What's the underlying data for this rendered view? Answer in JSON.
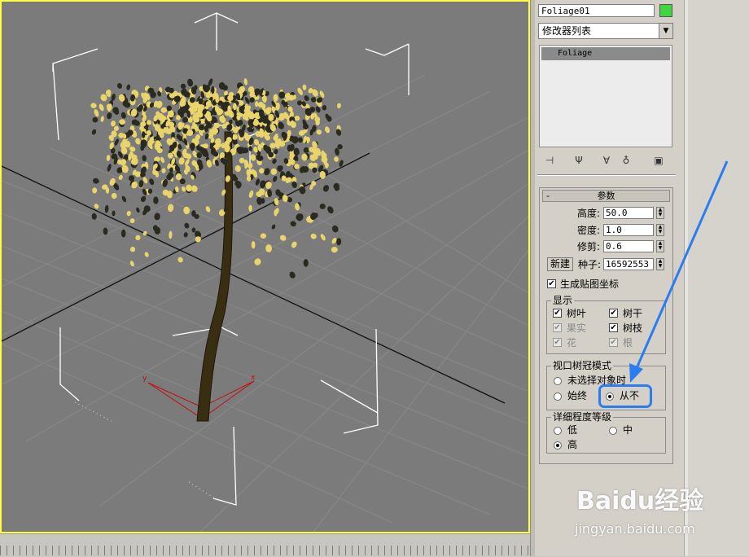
{
  "object": {
    "name": "Foliage01",
    "color": "#3fd63f"
  },
  "modifier_list": {
    "label": "修改器列表"
  },
  "modifier_stack": {
    "items": [
      "Foliage"
    ]
  },
  "viewport": {
    "axes": {
      "x": "x",
      "y": "y"
    },
    "border_color": "#ffff40"
  },
  "parameters": {
    "title": "参数",
    "collapse_symbol": "-",
    "height_label": "高度:",
    "height_value": "50.0",
    "density_label": "密度:",
    "density_value": "1.0",
    "prune_label": "修剪:",
    "prune_value": "0.6",
    "new_button": "新建",
    "seed_label": "种子:",
    "seed_value": "16592553",
    "gen_mapping_label": "生成贴图坐标",
    "gen_mapping_checked": true
  },
  "display": {
    "title": "显示",
    "leaves": {
      "label": "树叶",
      "checked": true,
      "enabled": true
    },
    "trunk": {
      "label": "树干",
      "checked": true,
      "enabled": true
    },
    "fruit": {
      "label": "果实",
      "checked": true,
      "enabled": false
    },
    "branches": {
      "label": "树枝",
      "checked": true,
      "enabled": true
    },
    "flowers": {
      "label": "花",
      "checked": true,
      "enabled": false
    },
    "roots": {
      "label": "根",
      "checked": true,
      "enabled": false
    }
  },
  "canopy_mode": {
    "title": "视口树冠模式",
    "options": [
      "未选择对象时",
      "始终",
      "从不"
    ],
    "selected": "从不"
  },
  "detail_level": {
    "title": "详细程度等级",
    "options": [
      "低",
      "中",
      "高"
    ],
    "selected": "高"
  },
  "annotation": {
    "color": "#2a7df0"
  },
  "watermark": {
    "brand": "Baidu经验",
    "url": "jingyan.baidu.com"
  }
}
